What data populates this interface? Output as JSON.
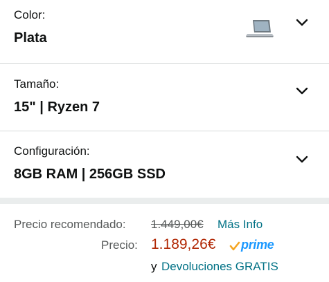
{
  "options": {
    "color": {
      "label": "Color:",
      "value": "Plata",
      "thumbnail_icon": "laptop-thumbnail"
    },
    "size": {
      "label": "Tamaño:",
      "value": "15\" | Ryzen 7"
    },
    "config": {
      "label": "Configuración:",
      "value": "8GB RAM | 256GB SSD"
    },
    "chevron_icon": "chevron-down-icon"
  },
  "pricing": {
    "list_price_label": "Precio recomendado:",
    "list_price": "1.449,00€",
    "more_info": "Más Info",
    "price_label": "Precio:",
    "price": "1.189,26€",
    "prime_label": "prime",
    "returns_prefix": "y",
    "returns_link": "Devoluciones GRATIS"
  },
  "colors": {
    "price_red": "#b12704",
    "link_teal": "#007185",
    "prime_blue": "#1a98ff",
    "prime_check_orange": "#f5a623",
    "separator": "#eaeded"
  }
}
